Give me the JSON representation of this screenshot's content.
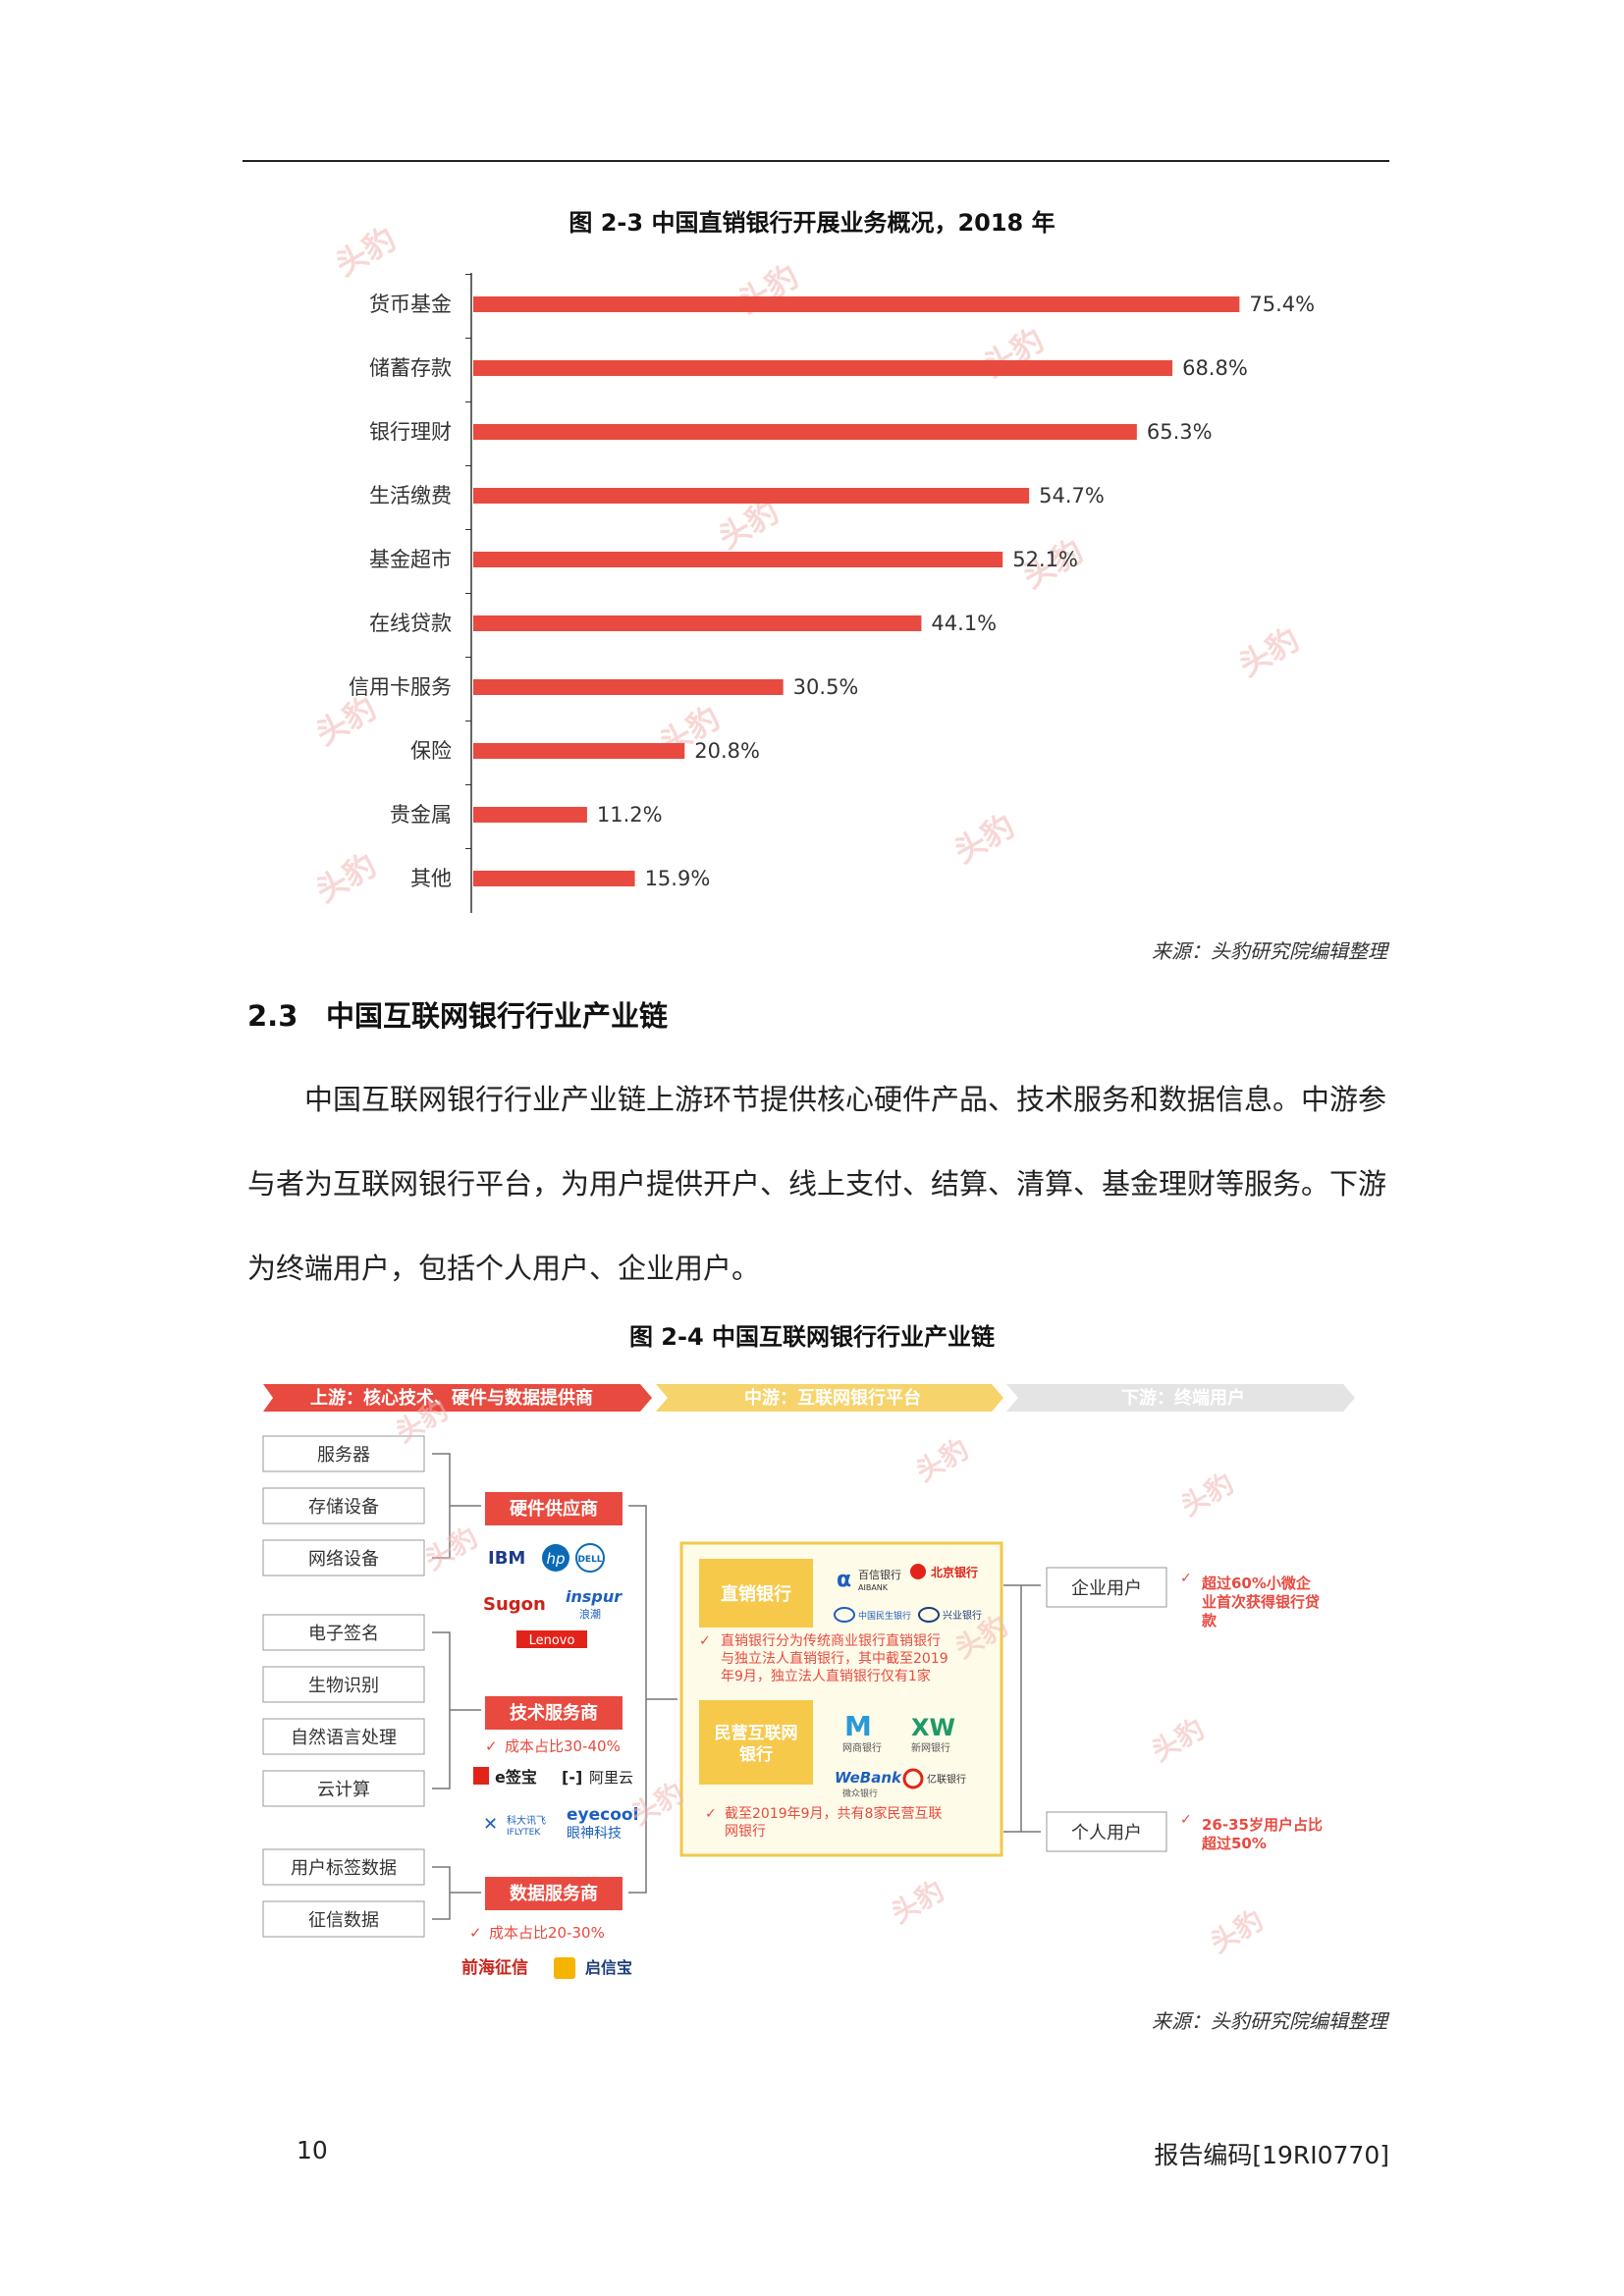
{
  "figure1": {
    "title": "图 2-3 中国直销银行开展业务概况，2018 年",
    "source": "来源：头豹研究院编辑整理"
  },
  "chart_data": {
    "type": "bar",
    "orientation": "horizontal",
    "title": "图 2-3 中国直销银行开展业务概况，2018 年",
    "categories": [
      "货币基金",
      "储蓄存款",
      "银行理财",
      "生活缴费",
      "基金超市",
      "在线贷款",
      "信用卡服务",
      "保险",
      "贵金属",
      "其他"
    ],
    "values": [
      75.4,
      68.8,
      65.3,
      54.7,
      52.1,
      44.1,
      30.5,
      20.8,
      11.2,
      15.9
    ],
    "value_labels": [
      "75.4%",
      "68.8%",
      "65.3%",
      "54.7%",
      "52.1%",
      "44.1%",
      "30.5%",
      "20.8%",
      "11.2%",
      "15.9%"
    ],
    "unit": "%",
    "xlim": [
      0,
      100
    ],
    "bar_color": "#e84a3f",
    "grid": false,
    "legend": "none"
  },
  "section": {
    "number": "2.3",
    "title": "中国互联网银行行业产业链"
  },
  "paragraph_lines": [
    "中国互联网银行行业产业链上游环节提供核心硬件产品、技术服务和数据信息。中游参",
    "与者为互联网银行平台，为用户提供开户、线上支付、结算、清算、基金理财等服务。下游",
    "为终端用户，包括个人用户、企业用户。"
  ],
  "figure2": {
    "title": "图 2-4 中国互联网银行行业产业链",
    "source": "来源：头豹研究院编辑整理",
    "stages": {
      "upstream": "上游：核心技术、硬件与数据提供商",
      "midstream": "中游：互联网银行平台",
      "downstream": "下游：终端用户"
    },
    "items": {
      "hardware": [
        "服务器",
        "存储设备",
        "网络设备"
      ],
      "tech": [
        "电子签名",
        "生物识别",
        "自然语言处理",
        "云计算"
      ],
      "data": [
        "用户标签数据",
        "征信数据"
      ]
    },
    "providers": {
      "hardware": "硬件供应商",
      "tech": "技术服务商",
      "tech_note": "成本占比30-40%",
      "data": "数据服务商",
      "data_note": "成本占比20-30%"
    },
    "logos": {
      "ibm": "IBM",
      "hp": "hp",
      "dell": "DELL",
      "sugon": "Sugon",
      "inspur": "inspur",
      "inspur_cn": "浪潮",
      "lenovo": "Lenovo",
      "esign": "e签宝",
      "aliyun": "阿里云",
      "iflytek": "科大讯飞",
      "iflytek_en": "IFLYTEK",
      "eyecool": "eyecool",
      "eyecool_cn": "眼神科技",
      "qianhai": "前海征信",
      "qixinbao": "启信宝",
      "aibank": "百信银行",
      "aibank_en": "AIBANK",
      "bob": "北京银行",
      "cmbc": "中国民生银行",
      "cib": "兴业银行",
      "mybank": "网商银行",
      "xw": "XW",
      "xw_cn": "新网银行",
      "webank": "WeBank",
      "webank_cn": "微众银行",
      "yillion": "亿联银行"
    },
    "platforms": {
      "direct": "直销银行",
      "direct_note_lines": [
        "直销银行分为传统商业银行直销银行",
        "与独立法人直销银行，其中截至2019",
        "年9月，独立法人直销银行仅有1家"
      ],
      "private_lines": [
        "民营互联网",
        "银行"
      ],
      "private_note_lines": [
        "截至2019年9月，共有8家民营互联",
        "网银行"
      ]
    },
    "users": {
      "enterprise": "企业用户",
      "enterprise_note_lines": [
        "超过60%小微企",
        "业首次获得银行贷",
        "款"
      ],
      "personal": "个人用户",
      "personal_note_lines": [
        "26-35岁用户占比",
        "超过50%"
      ]
    }
  },
  "footer": {
    "page": "10",
    "code": "报告编码[19RI0770]"
  }
}
